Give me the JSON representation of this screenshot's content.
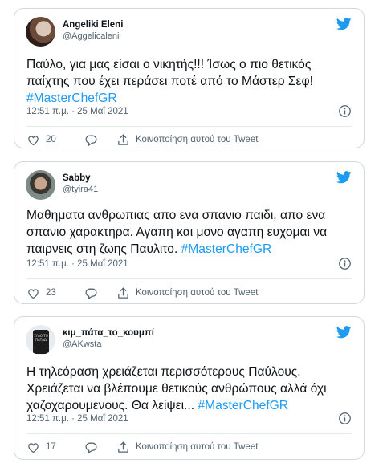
{
  "tweets": [
    {
      "display_name": "Angeliki Eleni",
      "handle": "@Aggelicaleni",
      "text": "Παύλο, για μας είσαι ο νικητής!!! Ίσως ο πιο θετικός παίχτης που έχει περάσει ποτέ από το Μάστερ Σεφ!",
      "hashtag": "#MasterChefGR",
      "time": "12:51 π.μ. · 25 Μαΐ 2021",
      "likes": "20",
      "share_label": "Κοινοποίηση αυτού του Tweet"
    },
    {
      "display_name": "Sabby",
      "handle": "@tyira41",
      "text": "Μαθηματα ανθρωπιας απο ενα σπανιο παιδι, απο ενα σπανιο χαρακτηρα. Αγαπη και μονο αγαπη ευχομαι να παιρνεις στη ζωης Παυλιτο.",
      "hashtag": "#MasterChefGR",
      "time": "12:51 π.μ. · 25 Μαΐ 2021",
      "likes": "23",
      "share_label": "Κοινοποίηση αυτού του Tweet"
    },
    {
      "display_name": "κιμ_πάτα_το_κουμπί",
      "handle": "@AKwsta",
      "text": "Η τηλεόραση χρειάζεται περισσότερους Παύλους. Χρειάζεται να βλέπουμε θετικούς ανθρώπους αλλά όχι χαζοχαρουμενους. Θα λείψει...",
      "hashtag": "#MasterChefGR",
      "time": "12:51 π.μ. · 25 Μαΐ 2021",
      "likes": "17",
      "share_label": "Κοινοποίηση αυτού του Tweet",
      "avatar_shirt_text": "ΞΥΛΟ ΤΟ ΠΑΤΑΩ"
    }
  ],
  "colors": {
    "twitter_blue": "#1d9bf0",
    "text": "#0f1419",
    "secondary": "#536471",
    "border": "#cfd9de"
  },
  "icons": [
    "twitter-bird-icon",
    "info-icon",
    "heart-icon",
    "reply-icon",
    "share-icon"
  ]
}
